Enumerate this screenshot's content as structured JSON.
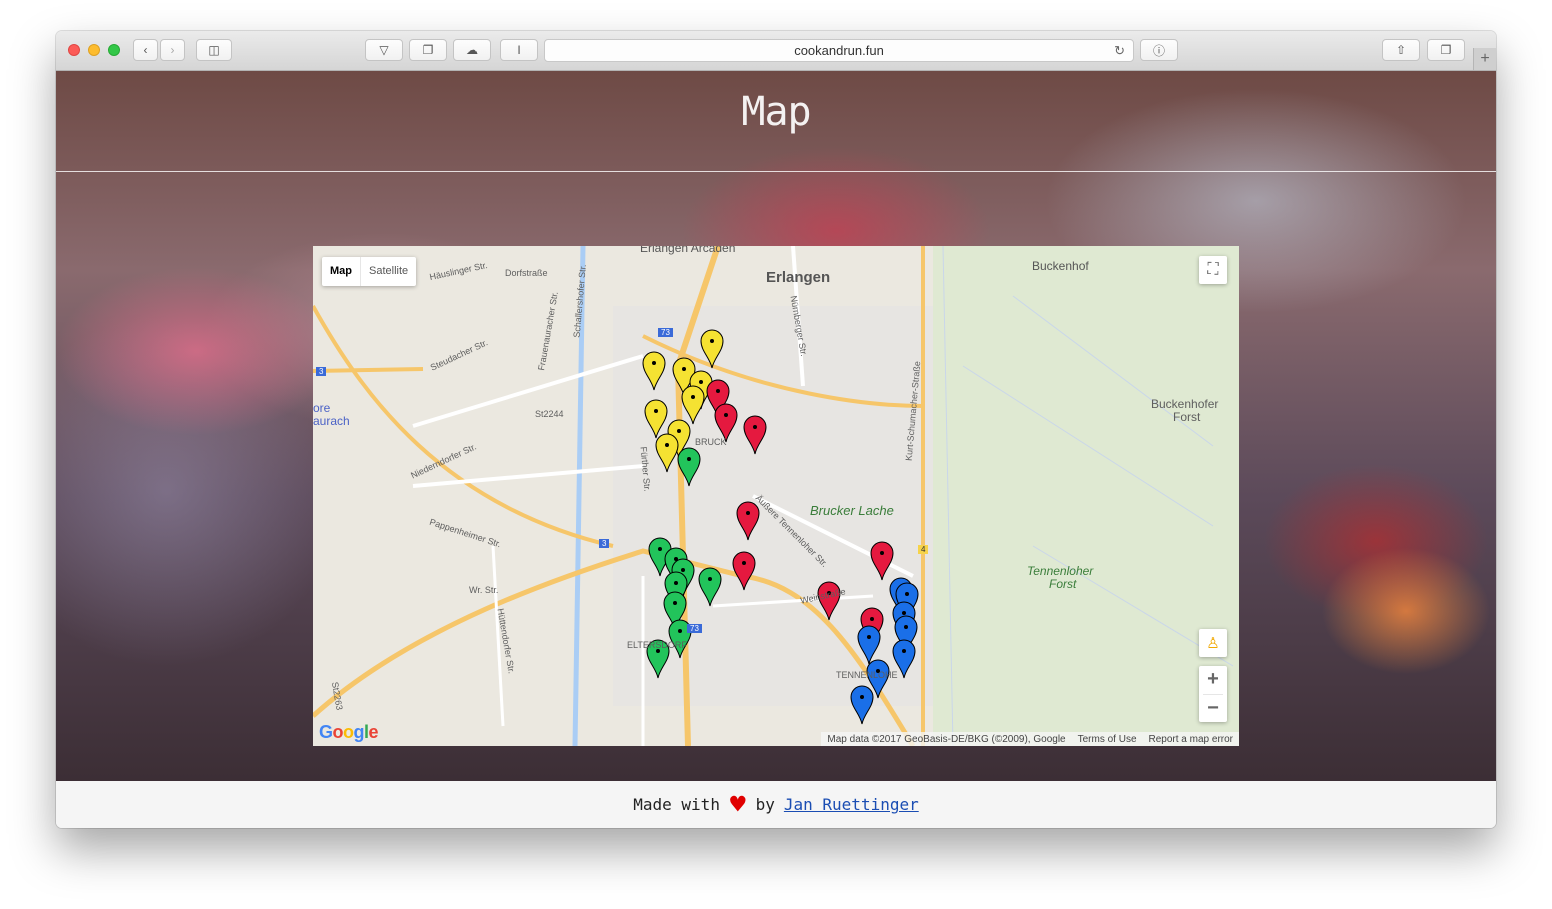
{
  "browser": {
    "url": "cookandrun.fun"
  },
  "page": {
    "title": "Map"
  },
  "map": {
    "type_controls": {
      "map": "Map",
      "satellite": "Satellite"
    },
    "labels": {
      "erlangen": "Erlangen",
      "erlangen_arcaden": "Erlangen Arcaden",
      "buckenhof": "Buckenhof",
      "buckenhofer_forst_1": "Buckenhofer",
      "buckenhofer_forst_2": "Forst",
      "brucker_lache": "Brucker Lache",
      "tennenloher_forst_1": "Tennenloher",
      "tennenloher_forst_2": "Forst",
      "bruck": "BRUCK",
      "eltersdorf": "ELTERSDORF",
      "tennenlohe": "TENNENLOHE",
      "aurach_1": "ore",
      "aurach_2": "aurach",
      "haeuslinger": "Häuslinger Str.",
      "dorfstrasse": "Dorfstraße",
      "steudacher": "Steudacher Str.",
      "niederndorfer": "Niederndorfer Str.",
      "pappenheimer": "Pappenheimer Str.",
      "wr_str": "Wr. Str.",
      "huettendorfer": "Hüttendorfer Str.",
      "st2244": "St2244",
      "st2263": "St2263",
      "schallershofer": "Schallershofer Str.",
      "frauenauracher": "Frauenauracher Str.",
      "fuerther": "Fürther Str.",
      "nuernberger": "Nürnberger Str.",
      "aeussere_tennenloher": "Äußere Tennenloher Str.",
      "weinstrasse": "Weinstraße",
      "kurt_schumacher": "Kurt-Schumacher-Straße",
      "a3_1": "3",
      "a3_2": "3",
      "a73_1": "73",
      "a73_2": "73",
      "b4": "4"
    },
    "attribution": {
      "data": "Map data ©2017 GeoBasis-DE/BKG (©2009), Google",
      "terms": "Terms of Use",
      "report": "Report a map error"
    },
    "google": "Google",
    "marker_colors": {
      "yellow": "#f5e232",
      "red": "#e5193f",
      "green": "#22c45b",
      "blue": "#1a6fe8"
    },
    "markers": [
      {
        "color": "yellow"
      },
      {
        "color": "yellow"
      },
      {
        "color": "yellow"
      },
      {
        "color": "yellow"
      },
      {
        "color": "yellow"
      },
      {
        "color": "yellow"
      },
      {
        "color": "yellow"
      },
      {
        "color": "yellow"
      },
      {
        "color": "red"
      },
      {
        "color": "red"
      },
      {
        "color": "red"
      },
      {
        "color": "red"
      },
      {
        "color": "red"
      },
      {
        "color": "red"
      },
      {
        "color": "red"
      },
      {
        "color": "red"
      },
      {
        "color": "green"
      },
      {
        "color": "green"
      },
      {
        "color": "green"
      },
      {
        "color": "green"
      },
      {
        "color": "green"
      },
      {
        "color": "green"
      },
      {
        "color": "green"
      },
      {
        "color": "green"
      },
      {
        "color": "green"
      },
      {
        "color": "blue"
      },
      {
        "color": "blue"
      },
      {
        "color": "blue"
      },
      {
        "color": "blue"
      },
      {
        "color": "blue"
      },
      {
        "color": "blue"
      },
      {
        "color": "blue"
      },
      {
        "color": "blue"
      }
    ]
  },
  "footer": {
    "made_with": "Made with",
    "heart": "♥",
    "by": "by",
    "author": "Jan Ruettinger"
  }
}
